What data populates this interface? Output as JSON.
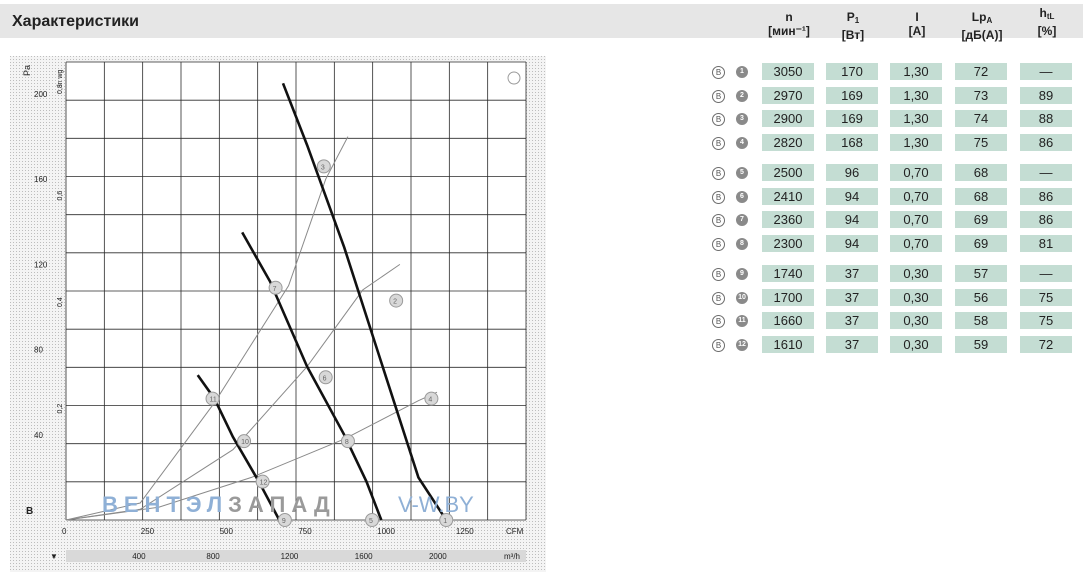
{
  "header": {
    "title": "Характеристики"
  },
  "table": {
    "columns": [
      {
        "line1": "n",
        "line2": "[мин⁻¹]"
      },
      {
        "line1": "P",
        "sub": "1",
        "line2": "[Вт]"
      },
      {
        "line1": "I",
        "line2": "[А]"
      },
      {
        "line1": "Lp",
        "sub": "A",
        "line2": "[дБ(А)]"
      },
      {
        "line1": "h",
        "sub": "tL",
        "line2": "[%]"
      }
    ],
    "marker_letter": "B",
    "rows": [
      {
        "num": "1",
        "n": "3050",
        "p1": "170",
        "i": "1,30",
        "lp": "72",
        "h": "—"
      },
      {
        "num": "2",
        "n": "2970",
        "p1": "169",
        "i": "1,30",
        "lp": "73",
        "h": "89"
      },
      {
        "num": "3",
        "n": "2900",
        "p1": "169",
        "i": "1,30",
        "lp": "74",
        "h": "88"
      },
      {
        "num": "4",
        "n": "2820",
        "p1": "168",
        "i": "1,30",
        "lp": "75",
        "h": "86"
      },
      {
        "num": "5",
        "n": "2500",
        "p1": "96",
        "i": "0,70",
        "lp": "68",
        "h": "—"
      },
      {
        "num": "6",
        "n": "2410",
        "p1": "94",
        "i": "0,70",
        "lp": "68",
        "h": "86"
      },
      {
        "num": "7",
        "n": "2360",
        "p1": "94",
        "i": "0,70",
        "lp": "69",
        "h": "86"
      },
      {
        "num": "8",
        "n": "2300",
        "p1": "94",
        "i": "0,70",
        "lp": "69",
        "h": "81"
      },
      {
        "num": "9",
        "n": "1740",
        "p1": "37",
        "i": "0,30",
        "lp": "57",
        "h": "—"
      },
      {
        "num": "10",
        "n": "1700",
        "p1": "37",
        "i": "0,30",
        "lp": "56",
        "h": "75"
      },
      {
        "num": "11",
        "n": "1660",
        "p1": "37",
        "i": "0,30",
        "lp": "58",
        "h": "75"
      },
      {
        "num": "12",
        "n": "1610",
        "p1": "37",
        "i": "0,30",
        "lp": "59",
        "h": "72"
      }
    ]
  },
  "watermark": {
    "part1": "ВЕНТЭЛ",
    "part2": "ЗАПАД",
    "part3": "V-W.BY"
  },
  "colors": {
    "cell_bg": "#c4ddd3",
    "grid": "#2a2a2a",
    "curve": "#111111",
    "watermark_blue": "#8fb0d6",
    "watermark_gray": "#9a9a9a"
  },
  "chart_data": {
    "type": "line",
    "title": "",
    "xlabel_top": "cfm",
    "xlabel_bottom": "m³/h",
    "ylabel": "Pa",
    "ylabel_alt": "in wg",
    "x_ticks_top": [
      "0",
      "250",
      "500",
      "750",
      "1000",
      "1250",
      "CFM"
    ],
    "x_ticks_bottom": [
      "400",
      "800",
      "1200",
      "1600",
      "2000",
      "m³/h"
    ],
    "y_ticks": [
      "40",
      "80",
      "120",
      "160",
      "200"
    ],
    "y_ticks_alt": [
      "0,2",
      "0,4",
      "0,6",
      "0,8"
    ],
    "xlim": [
      0,
      2480
    ],
    "ylim": [
      0,
      215
    ],
    "corner_label": "B",
    "curves": [
      {
        "name": "high",
        "points": [
          [
            1170,
            205
          ],
          [
            1300,
            176
          ],
          [
            1500,
            128
          ],
          [
            1700,
            74
          ],
          [
            1900,
            20
          ],
          [
            2050,
            0
          ]
        ]
      },
      {
        "name": "mid",
        "points": [
          [
            950,
            135
          ],
          [
            1100,
            112
          ],
          [
            1300,
            72
          ],
          [
            1500,
            40
          ],
          [
            1620,
            18
          ],
          [
            1700,
            0
          ]
        ]
      },
      {
        "name": "low",
        "points": [
          [
            710,
            68
          ],
          [
            800,
            57
          ],
          [
            900,
            39
          ],
          [
            1040,
            18
          ],
          [
            1150,
            0
          ]
        ]
      }
    ],
    "system_lines": [
      {
        "points": [
          [
            0,
            0
          ],
          [
            400,
            8
          ],
          [
            800,
            55
          ],
          [
            1200,
            110
          ],
          [
            1400,
            160
          ],
          [
            1520,
            180
          ]
        ]
      },
      {
        "points": [
          [
            0,
            0
          ],
          [
            400,
            5
          ],
          [
            900,
            33
          ],
          [
            1300,
            72
          ],
          [
            1600,
            108
          ],
          [
            1800,
            120
          ]
        ]
      },
      {
        "points": [
          [
            0,
            0
          ],
          [
            500,
            6
          ],
          [
            1000,
            20
          ],
          [
            1500,
            38
          ],
          [
            1900,
            56
          ],
          [
            2000,
            60
          ]
        ]
      }
    ],
    "operating_points": [
      {
        "label": "1",
        "x": 2050,
        "y": 0
      },
      {
        "label": "2",
        "x": 1780,
        "y": 103
      },
      {
        "label": "3",
        "x": 1390,
        "y": 166
      },
      {
        "label": "4",
        "x": 1970,
        "y": 57
      },
      {
        "label": "5",
        "x": 1650,
        "y": 0
      },
      {
        "label": "6",
        "x": 1400,
        "y": 67
      },
      {
        "label": "7",
        "x": 1130,
        "y": 109
      },
      {
        "label": "8",
        "x": 1520,
        "y": 37
      },
      {
        "label": "9",
        "x": 1180,
        "y": 0
      },
      {
        "label": "10",
        "x": 960,
        "y": 37
      },
      {
        "label": "11",
        "x": 790,
        "y": 57
      },
      {
        "label": "12",
        "x": 1060,
        "y": 18
      }
    ],
    "grid": true,
    "legend": "none"
  }
}
